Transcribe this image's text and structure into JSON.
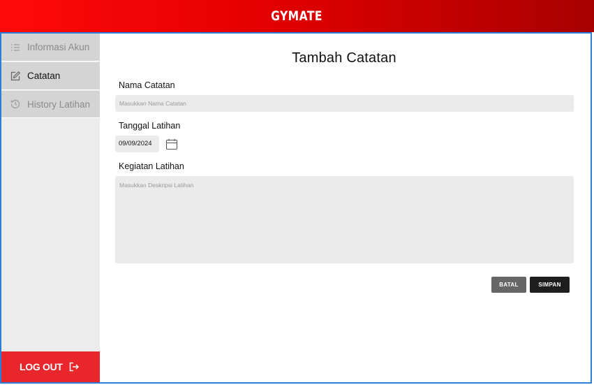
{
  "header": {
    "brand": "GYMATE"
  },
  "sidebar": {
    "items": [
      {
        "label": "Informasi Akun",
        "icon": "list-icon"
      },
      {
        "label": "Catatan",
        "icon": "edit-icon"
      },
      {
        "label": "History Latihan",
        "icon": "history-icon"
      }
    ],
    "logout_label": "LOG OUT"
  },
  "form": {
    "title": "Tambah Catatan",
    "nama_label": "Nama Catatan",
    "nama_placeholder": "Masukkan Nama Catatan",
    "tanggal_label": "Tanggal Latihan",
    "tanggal_value": "09/09/2024",
    "kegiatan_label": "Kegiatan Latihan",
    "kegiatan_placeholder": "Masukkan Deskripsi Latihan",
    "batal_label": "BATAL",
    "simpan_label": "SIMPAN"
  },
  "colors": {
    "header_red": "#ff0a0a",
    "header_dark": "#a80000",
    "logout_red": "#e8262c",
    "accent_border": "#2a7fd4"
  }
}
